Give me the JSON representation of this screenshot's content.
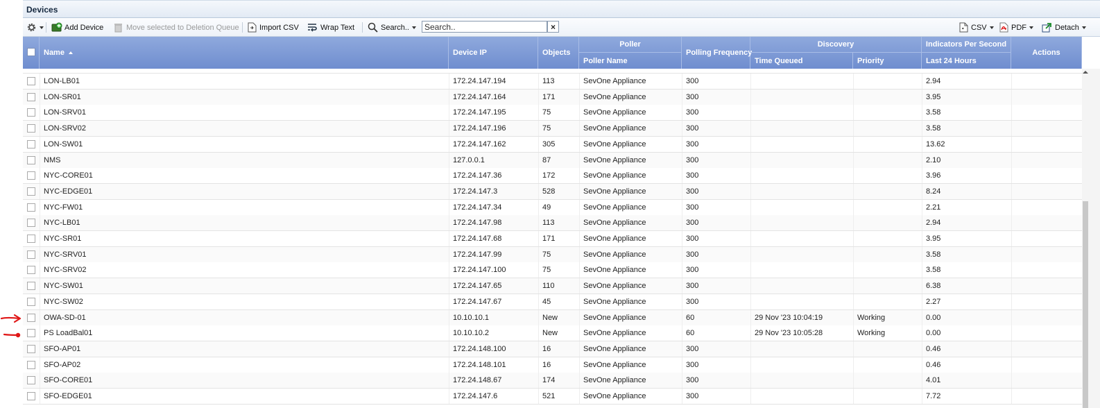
{
  "panel": {
    "title": "Devices"
  },
  "toolbar": {
    "add_device": "Add Device",
    "move_to_deletion": "Move selected to Deletion Queue",
    "import_csv": "Import CSV",
    "wrap_text": "Wrap Text",
    "search_menu": "Search..",
    "search_placeholder": "Search..",
    "clear": "×",
    "csv": "CSV",
    "pdf": "PDF",
    "detach": "Detach"
  },
  "columns": {
    "name": "Name",
    "device_ip": "Device IP",
    "objects": "Objects",
    "poller": "Poller",
    "poller_name": "Poller Name",
    "polling_frequency": "Polling Frequency",
    "discovery": "Discovery",
    "time_queued": "Time Queued",
    "priority": "Priority",
    "indicators_per_second": "Indicators Per Second",
    "last_24_hours": "Last 24 Hours",
    "actions": "Actions"
  },
  "rows": [
    {
      "name": "LON-LB01",
      "ip": "172.24.147.194",
      "objects": "113",
      "poller": "SevOne Appliance",
      "freq": "300",
      "time": "",
      "priority": "",
      "ips": "2.94"
    },
    {
      "name": "LON-SR01",
      "ip": "172.24.147.164",
      "objects": "171",
      "poller": "SevOne Appliance",
      "freq": "300",
      "time": "",
      "priority": "",
      "ips": "3.95"
    },
    {
      "name": "LON-SRV01",
      "ip": "172.24.147.195",
      "objects": "75",
      "poller": "SevOne Appliance",
      "freq": "300",
      "time": "",
      "priority": "",
      "ips": "3.58"
    },
    {
      "name": "LON-SRV02",
      "ip": "172.24.147.196",
      "objects": "75",
      "poller": "SevOne Appliance",
      "freq": "300",
      "time": "",
      "priority": "",
      "ips": "3.58"
    },
    {
      "name": "LON-SW01",
      "ip": "172.24.147.162",
      "objects": "305",
      "poller": "SevOne Appliance",
      "freq": "300",
      "time": "",
      "priority": "",
      "ips": "13.62"
    },
    {
      "name": "NMS",
      "ip": "127.0.0.1",
      "objects": "87",
      "poller": "SevOne Appliance",
      "freq": "300",
      "time": "",
      "priority": "",
      "ips": "2.10"
    },
    {
      "name": "NYC-CORE01",
      "ip": "172.24.147.36",
      "objects": "172",
      "poller": "SevOne Appliance",
      "freq": "300",
      "time": "",
      "priority": "",
      "ips": "3.96"
    },
    {
      "name": "NYC-EDGE01",
      "ip": "172.24.147.3",
      "objects": "528",
      "poller": "SevOne Appliance",
      "freq": "300",
      "time": "",
      "priority": "",
      "ips": "8.24"
    },
    {
      "name": "NYC-FW01",
      "ip": "172.24.147.34",
      "objects": "49",
      "poller": "SevOne Appliance",
      "freq": "300",
      "time": "",
      "priority": "",
      "ips": "2.21"
    },
    {
      "name": "NYC-LB01",
      "ip": "172.24.147.98",
      "objects": "113",
      "poller": "SevOne Appliance",
      "freq": "300",
      "time": "",
      "priority": "",
      "ips": "2.94"
    },
    {
      "name": "NYC-SR01",
      "ip": "172.24.147.68",
      "objects": "171",
      "poller": "SevOne Appliance",
      "freq": "300",
      "time": "",
      "priority": "",
      "ips": "3.95"
    },
    {
      "name": "NYC-SRV01",
      "ip": "172.24.147.99",
      "objects": "75",
      "poller": "SevOne Appliance",
      "freq": "300",
      "time": "",
      "priority": "",
      "ips": "3.58"
    },
    {
      "name": "NYC-SRV02",
      "ip": "172.24.147.100",
      "objects": "75",
      "poller": "SevOne Appliance",
      "freq": "300",
      "time": "",
      "priority": "",
      "ips": "3.58"
    },
    {
      "name": "NYC-SW01",
      "ip": "172.24.147.65",
      "objects": "110",
      "poller": "SevOne Appliance",
      "freq": "300",
      "time": "",
      "priority": "",
      "ips": "6.38"
    },
    {
      "name": "NYC-SW02",
      "ip": "172.24.147.67",
      "objects": "45",
      "poller": "SevOne Appliance",
      "freq": "300",
      "time": "",
      "priority": "",
      "ips": "2.27"
    },
    {
      "name": "OWA-SD-01",
      "ip": "10.10.10.1",
      "objects": "New",
      "poller": "SevOne Appliance",
      "freq": "60",
      "time": "29 Nov '23 10:04:19",
      "priority": "Working",
      "ips": "0.00"
    },
    {
      "name": "PS LoadBal01",
      "ip": "10.10.10.2",
      "objects": "New",
      "poller": "SevOne Appliance",
      "freq": "60",
      "time": "29 Nov '23 10:05:28",
      "priority": "Working",
      "ips": "0.00"
    },
    {
      "name": "SFO-AP01",
      "ip": "172.24.148.100",
      "objects": "16",
      "poller": "SevOne Appliance",
      "freq": "300",
      "time": "",
      "priority": "",
      "ips": "0.46"
    },
    {
      "name": "SFO-AP02",
      "ip": "172.24.148.101",
      "objects": "16",
      "poller": "SevOne Appliance",
      "freq": "300",
      "time": "",
      "priority": "",
      "ips": "0.46"
    },
    {
      "name": "SFO-CORE01",
      "ip": "172.24.148.67",
      "objects": "174",
      "poller": "SevOne Appliance",
      "freq": "300",
      "time": "",
      "priority": "",
      "ips": "4.01"
    },
    {
      "name": "SFO-EDGE01",
      "ip": "172.24.147.6",
      "objects": "521",
      "poller": "SevOne Appliance",
      "freq": "300",
      "time": "",
      "priority": "",
      "ips": "7.72"
    }
  ],
  "colors": {
    "header_blue": "#7b97d6",
    "annotation_red": "#e01818"
  }
}
